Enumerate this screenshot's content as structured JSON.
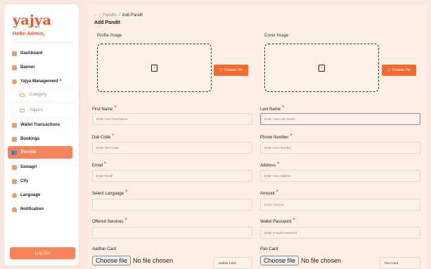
{
  "sidebar": {
    "logo": "yajya",
    "greeting": "Hello Admin,",
    "items": [
      {
        "label": "Dashboard"
      },
      {
        "label": "Banner"
      },
      {
        "label": "Yajya Management ^"
      },
      {
        "label": "Wallet Transactions"
      },
      {
        "label": "Bookings"
      },
      {
        "label": "Pandits"
      },
      {
        "label": "Samagri"
      },
      {
        "label": "City"
      },
      {
        "label": "Language"
      },
      {
        "label": "Notification"
      }
    ],
    "subitems": [
      {
        "label": "Category"
      },
      {
        "label": "Yajya's"
      }
    ],
    "logout": "Log Out",
    "accent": "#f7835a"
  },
  "breadcrumb": {
    "home_icon": "home-icon",
    "sep": "/",
    "crumb1": "Pandits",
    "crumb2": "Add Pandit"
  },
  "page_title": "Add Pandit",
  "images": {
    "profile_label": "Profile Image",
    "cover_label": "Cover Image",
    "choose_file": "Choose File"
  },
  "form": {
    "first_name": {
      "label": "First Name",
      "placeholder": "Enter Your First Name"
    },
    "last_name": {
      "label": "Last Name",
      "placeholder": "Enter Your Last Name"
    },
    "dial_code": {
      "label": "Dial Code",
      "placeholder": "Enter Dial Code"
    },
    "phone": {
      "label": "Phone Number",
      "placeholder": "Enter Your Number"
    },
    "email": {
      "label": "Email",
      "placeholder": "Enter Email"
    },
    "address": {
      "label": "Address",
      "placeholder": "Enter Your Address"
    },
    "language": {
      "label": "Select Language",
      "placeholder": ""
    },
    "amount": {
      "label": "Amount",
      "placeholder": "Enter Amount"
    },
    "services": {
      "label": "Offered Services",
      "placeholder": ""
    },
    "wallet_password": {
      "label": "Wallet Password",
      "placeholder": "Enter 4-Digit Password"
    },
    "aadhar": {
      "label": "Aadhar Card",
      "file_btn": "Choose file",
      "file_status": "No file chosen",
      "text": "Aadhar Card"
    },
    "pan": {
      "label": "Pan Card",
      "file_btn": "Choose file",
      "file_status": "No file chosen",
      "text": "Pan Card"
    },
    "required_mark": "*"
  },
  "colors": {
    "brand": "#e8572a",
    "button": "#f26a2e",
    "required": "#e02424"
  }
}
